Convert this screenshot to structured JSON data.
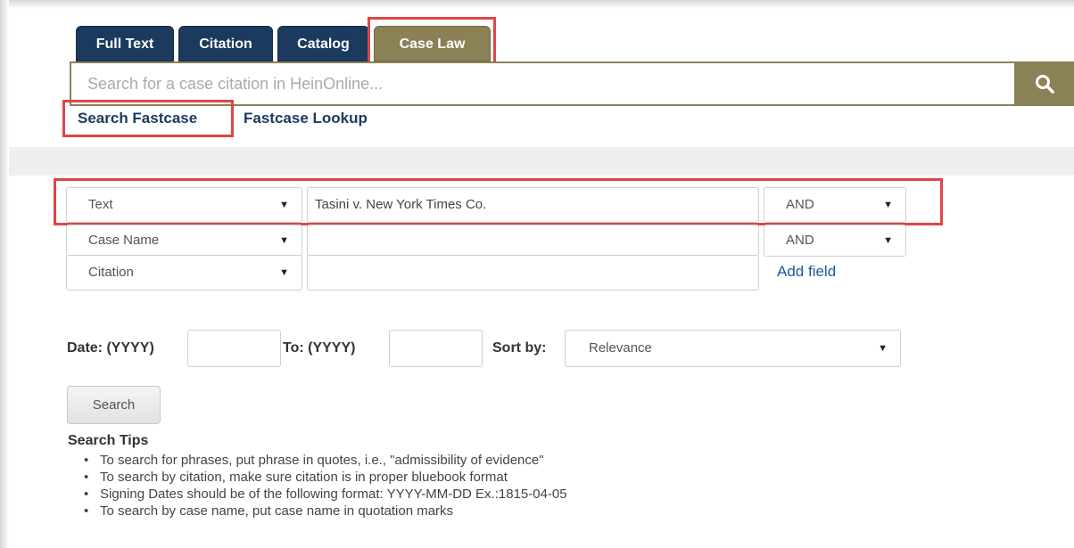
{
  "tabs": [
    {
      "label": "Full Text",
      "active": false
    },
    {
      "label": "Citation",
      "active": false
    },
    {
      "label": "Catalog",
      "active": false
    },
    {
      "label": "Case Law",
      "active": true
    }
  ],
  "search": {
    "placeholder": "Search for a case citation in HeinOnline...",
    "value": "",
    "button_icon": "search-icon"
  },
  "sublinks": {
    "search_fastcase": "Search Fastcase",
    "fastcase_lookup": "Fastcase Lookup"
  },
  "fields": [
    {
      "type": "Text",
      "value": "Tasini v. New York Times Co.",
      "operator": "AND"
    },
    {
      "type": "Case Name",
      "value": "",
      "operator": "AND"
    },
    {
      "type": "Citation",
      "value": ""
    }
  ],
  "add_field_label": "Add field",
  "filters": {
    "date_label": "Date: (YYYY)",
    "date_from": "",
    "to_label": "To: (YYYY)",
    "date_to": "",
    "sort_label": "Sort by:",
    "sort_value": "Relevance"
  },
  "search_button_label": "Search",
  "tips": {
    "title": "Search Tips",
    "items": [
      "To search for phrases, put phrase in quotes, i.e., \"admissibility of evidence\"",
      "To search by citation, make sure citation is in proper bluebook format",
      "Signing Dates should be of the following format: YYYY-MM-DD Ex.:1815-04-05",
      "To search by case name, put case name in quotation marks"
    ]
  },
  "colors": {
    "tab_dark": "#1b3a5e",
    "tab_active": "#8b8156",
    "highlight": "#e04545",
    "link": "#1b3a5e"
  }
}
